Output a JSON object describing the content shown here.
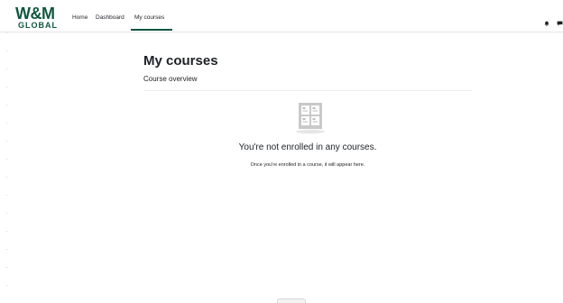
{
  "brand": {
    "logo_top": "W&M",
    "logo_bottom": "GLOBAL",
    "color": "#115740"
  },
  "nav": {
    "items": [
      {
        "label": "Home"
      },
      {
        "label": "Dashboard"
      },
      {
        "label": "My courses",
        "active": true
      }
    ],
    "icons": [
      "bell-icon",
      "chat-icon"
    ]
  },
  "main": {
    "page_title": "My courses",
    "section_title": "Course overview",
    "empty_state": {
      "icon": "courses-empty-icon",
      "heading": "You're not enrolled in any courses.",
      "message": "Once you're enrolled in a course, it will appear here."
    }
  }
}
